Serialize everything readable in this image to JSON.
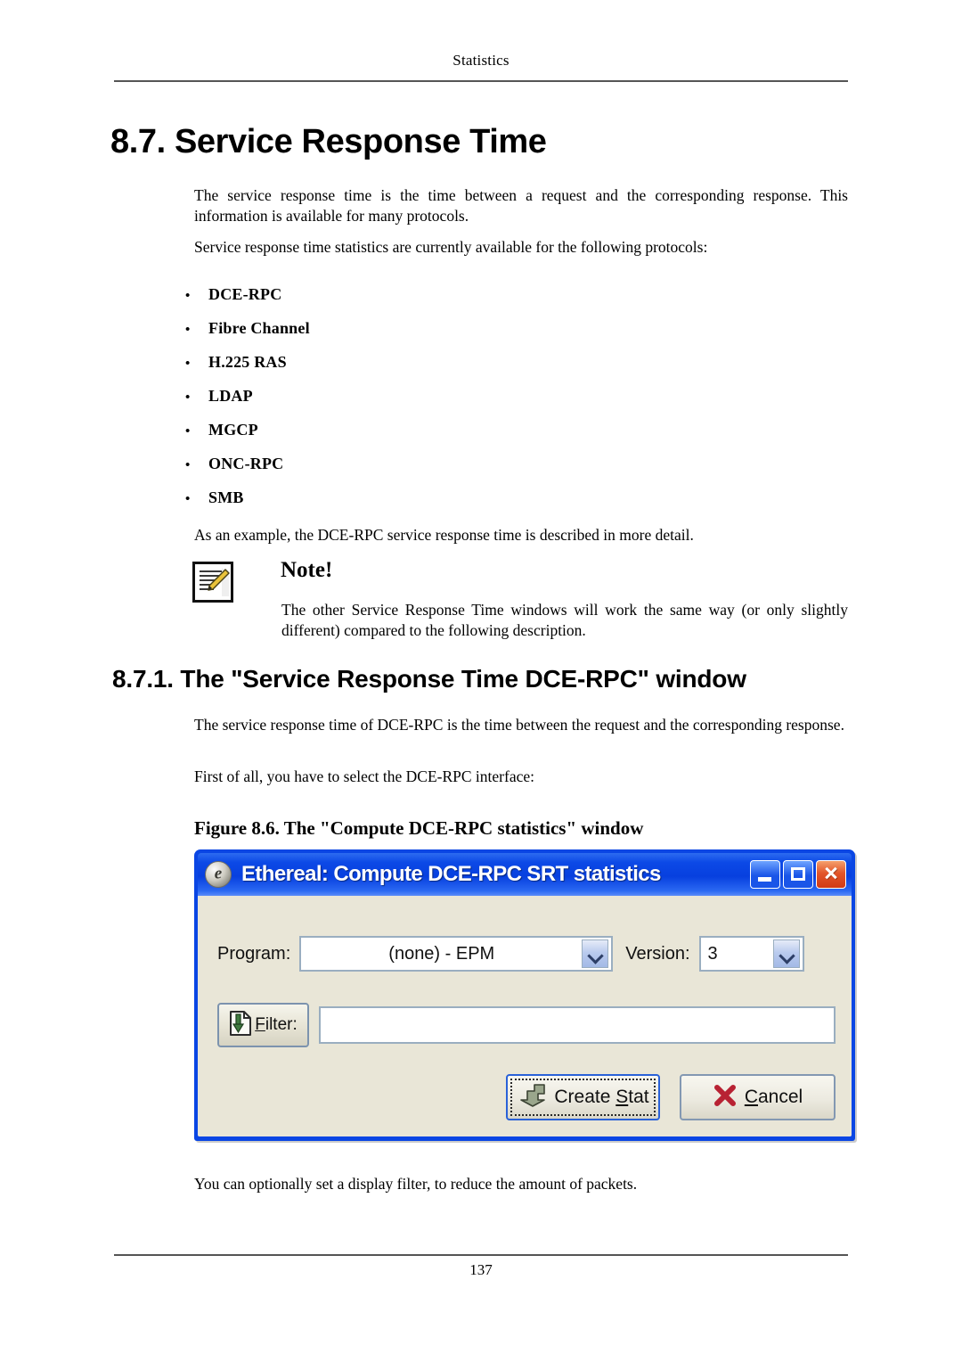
{
  "page": {
    "running_header": "Statistics",
    "page_number": "137"
  },
  "sections": {
    "h1": "8.7. Service Response Time",
    "intro_paragraph": "The service response time is the time between a request and the corresponding response. This information is available for many protocols.",
    "protocols_lead": "Service response time statistics are currently available for the following protocols:",
    "protocols": [
      {
        "bullet": "•",
        "label": "DCE-RPC"
      },
      {
        "bullet": "•",
        "label": "Fibre Channel"
      },
      {
        "bullet": "•",
        "label": "H.225 RAS"
      },
      {
        "bullet": "•",
        "label": "LDAP"
      },
      {
        "bullet": "•",
        "label": "MGCP"
      },
      {
        "bullet": "•",
        "label": "ONC-RPC"
      },
      {
        "bullet": "•",
        "label": "SMB"
      }
    ],
    "example_paragraph": "As an example, the DCE-RPC service response time is described in more detail.",
    "note": {
      "icon": "note-pad-pencil-icon",
      "title": "Note!",
      "body": "The other Service Response Time windows will work the same way (or only slightly different) compared to the following description."
    },
    "h2": "8.7.1. The \"Service Response Time DCE-RPC\" window",
    "h2_paragraph": "The service response time of DCE-RPC is the time between the request and the corresponding response.",
    "select_paragraph": "First of all, you have to select the DCE-RPC interface:",
    "figure_caption": "Figure 8.6. The \"Compute DCE-RPC statistics\" window",
    "closing_paragraph": "You can optionally set a display filter, to reduce the amount of packets."
  },
  "dialog": {
    "window_icon": "ethereal-logo-icon",
    "title": "Ethereal: Compute DCE-RPC SRT statistics",
    "window_buttons": {
      "minimize": "minimize-icon",
      "maximize": "maximize-icon",
      "close": "close-icon"
    },
    "program": {
      "label": "Program:",
      "value": "(none) - EPM",
      "dropdown_icon": "chevron-down-icon"
    },
    "version": {
      "label": "Version:",
      "value": "3",
      "dropdown_icon": "chevron-down-icon"
    },
    "filter": {
      "button_icon": "filter-page-arrow-icon",
      "button_label_pre": "F",
      "button_label_post": "ilter:",
      "input_value": "",
      "input_placeholder": ""
    },
    "actions": {
      "create": {
        "icon": "create-stat-arrow-icon",
        "label_pre": "Create ",
        "label_key": "S",
        "label_post": "tat"
      },
      "cancel": {
        "icon": "cancel-x-icon",
        "label_key": "C",
        "label_post": "ancel"
      }
    },
    "colors": {
      "titlebar_blue": "#0A46E4",
      "body_beige": "#E9E6D7",
      "close_red": "#E2562A",
      "default_border_blue": "#2A62D8"
    }
  }
}
